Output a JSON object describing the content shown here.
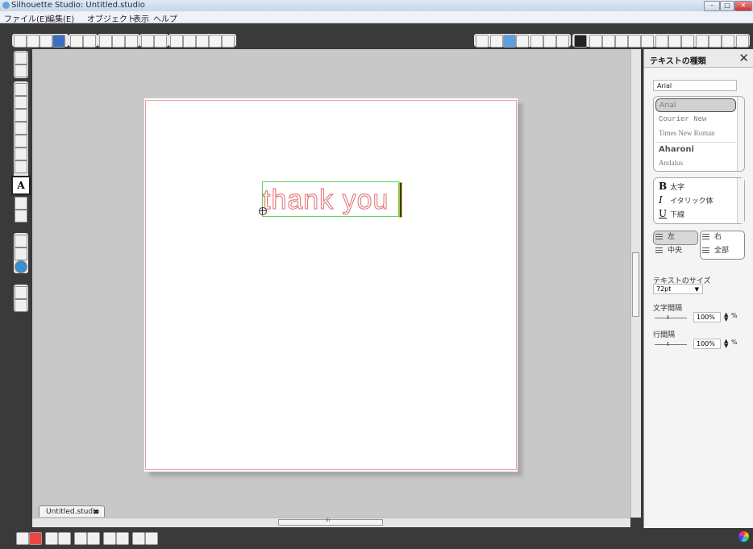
{
  "window": {
    "title": "Silhouette Studio: Untitled.studio",
    "controls": [
      "–",
      "□",
      "✕"
    ]
  },
  "menu": [
    "ファイル(E)",
    "編集(E)",
    "オブジェクト",
    "表示",
    "ヘルプ"
  ],
  "canvas": {
    "text_content": "thank you",
    "doc_tab": "Untitled.studio"
  },
  "panel": {
    "title": "テキストの種類",
    "font_input": "Arial",
    "fonts": [
      "Arial",
      "Courier New",
      "Times New Roman",
      "Aharoni",
      "Andalus"
    ],
    "selected_font": "Arial",
    "styles": [
      {
        "glyph": "B",
        "label": "太字"
      },
      {
        "glyph": "I",
        "label": "イタリック体"
      },
      {
        "glyph": "U",
        "label": "下線"
      }
    ],
    "align": {
      "left": "左",
      "right": "右",
      "center": "中央",
      "full": "全部"
    },
    "size_label": "テキストのサイズ",
    "size_value": "72pt",
    "char_spacing_label": "文字間隔",
    "char_spacing_value": "100%",
    "line_spacing_label": "行間隔",
    "line_spacing_value": "100%",
    "unit": "%"
  },
  "hscroll_label": "III",
  "colors": {
    "background": "#3a3a3a",
    "canvas": "#c8c8c8",
    "cut_line": "#e06b6b",
    "selection": "#5ed35e"
  }
}
